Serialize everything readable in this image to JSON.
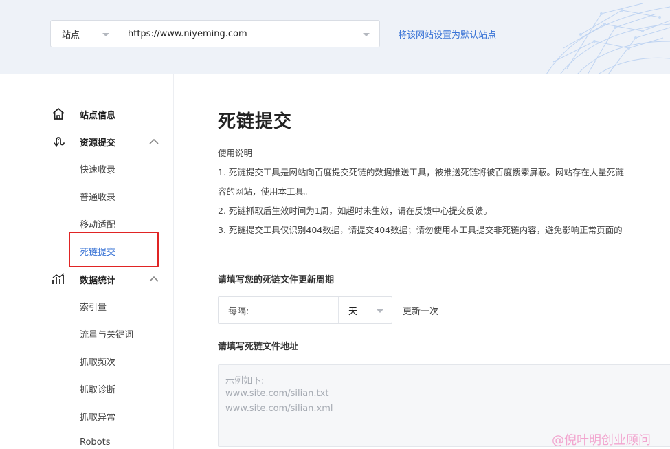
{
  "site_selector": {
    "label": "站点",
    "url": "https://www.niyeming.com",
    "set_default_link": "将该网站设置为默认站点"
  },
  "sidebar": {
    "groups": [
      {
        "label": "站点信息",
        "icon": "home-icon",
        "expanded": false
      },
      {
        "label": "资源提交",
        "icon": "submit-resource-icon",
        "expanded": true,
        "items": [
          "快速收录",
          "普通收录",
          "移动适配",
          "死链提交"
        ]
      },
      {
        "label": "数据统计",
        "icon": "stats-chart-icon",
        "expanded": true,
        "items": [
          "索引量",
          "流量与关键词",
          "抓取频次",
          "抓取诊断",
          "抓取异常",
          "Robots"
        ]
      }
    ],
    "active_item": "死链提交"
  },
  "main": {
    "title": "死链提交",
    "usage_heading": "使用说明",
    "usage_lines": [
      "1. 死链提交工具是网站向百度提交死链的数据推送工具，被推送死链将被百度搜索屏蔽。网站存在大量死链",
      "容的网站，使用本工具。",
      "2. 死链抓取后生效时间为1周，如超时未生效，请在反馈中心提交反馈。",
      "3. 死链提交工具仅识别404数据，请提交404数据；请勿使用本工具提交非死链内容，避免影响正常页面的"
    ],
    "period_label": "请填写您的死链文件更新周期",
    "period_prefix": "每隔:",
    "period_unit": "天",
    "period_suffix": "更新一次",
    "url_label": "请填写死链文件地址",
    "url_placeholder_lines": [
      "示例如下:",
      "www.site.com/silian.txt",
      "www.site.com/silian.xml"
    ]
  },
  "watermark": "@倪叶明创业顾问",
  "colors": {
    "accent": "#3a74d6",
    "highlight_border": "#e02424",
    "top_band": "#eef2f8",
    "watermark": "#f2a5cf"
  }
}
